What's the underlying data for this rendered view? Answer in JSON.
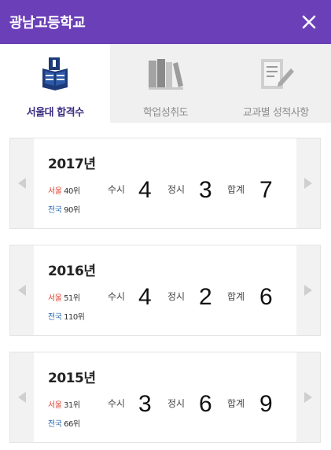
{
  "header": {
    "title": "광남고등학교",
    "close_icon": "close-icon"
  },
  "tabs": [
    {
      "label": "서울대 합격수",
      "icon": "university-book-icon",
      "active": true
    },
    {
      "label": "학업성취도",
      "icon": "books-icon",
      "active": false
    },
    {
      "label": "교과별 성적사항",
      "icon": "report-pencil-icon",
      "active": false
    }
  ],
  "labels": {
    "susi": "수시",
    "jeongsi": "정시",
    "total": "합계"
  },
  "cards": [
    {
      "year": "2017년",
      "seoul_label": "서울",
      "seoul_rank": "40위",
      "nation_label": "전국",
      "nation_rank": "90위",
      "susi": "4",
      "jeongsi": "3",
      "total": "7"
    },
    {
      "year": "2016년",
      "seoul_label": "서울",
      "seoul_rank": "51위",
      "nation_label": "전국",
      "nation_rank": "110위",
      "susi": "4",
      "jeongsi": "2",
      "total": "6"
    },
    {
      "year": "2015년",
      "seoul_label": "서울",
      "seoul_rank": "31위",
      "nation_label": "전국",
      "nation_rank": "66위",
      "susi": "3",
      "jeongsi": "6",
      "total": "9"
    }
  ],
  "colors": {
    "header": "#6a3fb8",
    "active_tab_text": "#3b2f83",
    "seoul": "#e04a3a",
    "nation": "#2f6db3"
  }
}
